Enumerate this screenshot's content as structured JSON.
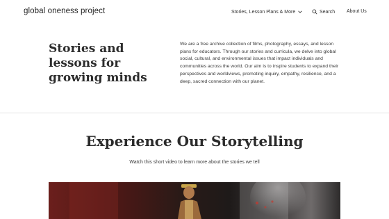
{
  "header": {
    "logo": "global oneness project",
    "nav": {
      "stories": "Stories, Lesson Plans & More",
      "search": "Search",
      "about": "About Us"
    }
  },
  "hero": {
    "title_lines": [
      "Stories and",
      "lessons for",
      "growing minds"
    ],
    "description": "We are a free archive collection of films, photography, essays, and lesson plans for educators. Through our stories and curricula, we delve into global social, cultural, and environmental issues that impact individuals and communities across the world. Our aim is to inspire students to expand their perspectives and worldviews, promoting inquiry, empathy, resilience, and a deep, sacred connection with our planet."
  },
  "storytelling": {
    "title": "Experience Our Storytelling",
    "subtitle": "Watch this short video to learn more about the stories we tell"
  }
}
